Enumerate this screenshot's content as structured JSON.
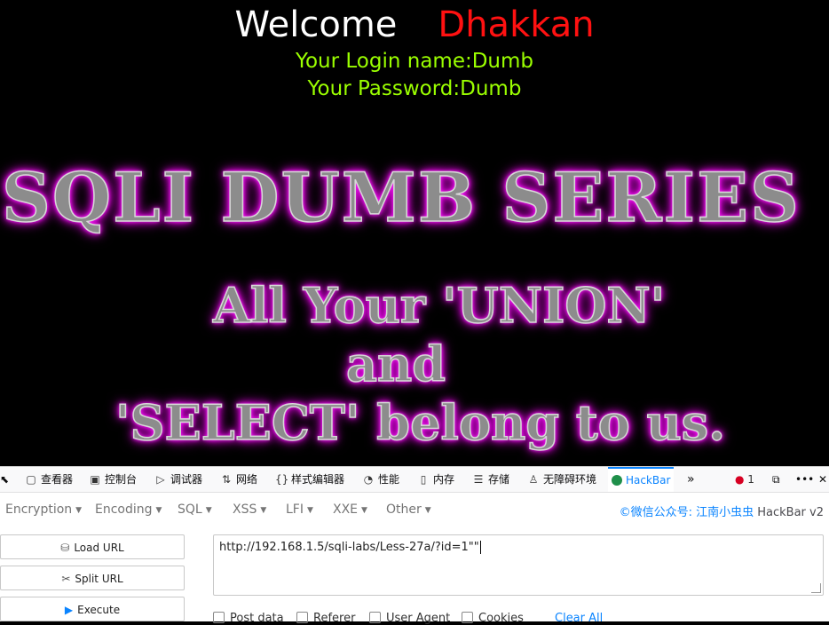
{
  "page": {
    "welcome_word": "Welcome",
    "welcome_name": "Dhakkan",
    "login_line": "Your Login name:Dumb",
    "password_line": "Your Password:Dumb",
    "banner": {
      "line1": "SQLI DUMB SERIES",
      "line2": "All Your 'UNION'",
      "line3": "and",
      "line4": "'SELECT' belong to us."
    }
  },
  "devtools": {
    "tabs": [
      {
        "icon": "inspector-icon",
        "label": "查看器"
      },
      {
        "icon": "console-icon",
        "label": "控制台"
      },
      {
        "icon": "debugger-icon",
        "label": "调试器"
      },
      {
        "icon": "network-icon",
        "label": "网络"
      },
      {
        "icon": "style-editor-icon",
        "label": "样式编辑器"
      },
      {
        "icon": "performance-icon",
        "label": "性能"
      },
      {
        "icon": "memory-icon",
        "label": "内存"
      },
      {
        "icon": "storage-icon",
        "label": "存储"
      },
      {
        "icon": "accessibility-icon",
        "label": "无障碍环境"
      },
      {
        "icon": "hackbar-icon",
        "label": "HackBar"
      }
    ],
    "error_count": "1",
    "colors": {
      "accent": "#0a84ff",
      "error": "#d70022"
    }
  },
  "hackbar": {
    "menus": [
      "Encryption",
      "Encoding",
      "SQL",
      "XSS",
      "LFI",
      "XXE",
      "Other"
    ],
    "brand_prefix": "©微信公众号: 江南小虫虫",
    "brand_suffix": "HackBar v2",
    "load_url": "Load URL",
    "split_url": "Split URL",
    "execute": "Execute",
    "url_value": "http://192.168.1.5/sqli-labs/Less-27a/?id=1\"\"",
    "options": [
      "Post data",
      "Referer",
      "User Agent",
      "Cookies"
    ],
    "clear_all": "Clear All"
  }
}
